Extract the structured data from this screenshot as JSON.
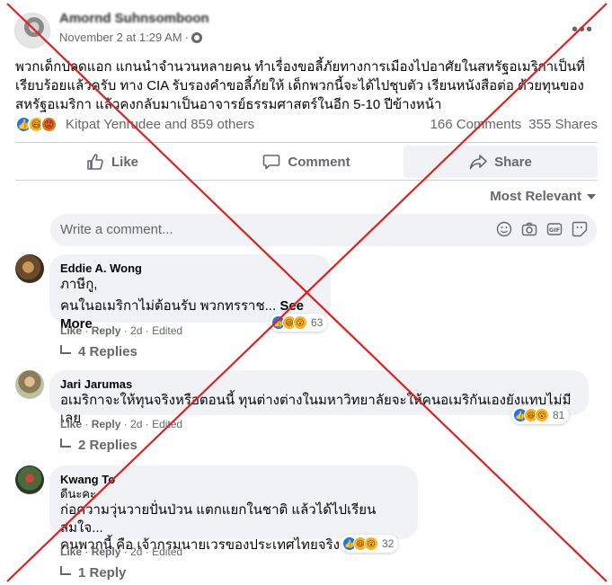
{
  "post": {
    "author": "Amornd Suhnsomboon",
    "timestamp": "November 2 at 1:29 AM",
    "separator": "·",
    "text": "พวกเด็กปลดแอก แกนนำจำนวนหลายคน ทำเรื่องขอลี้ภัยทางการเมืองไปอาศัยในสหรัฐอเมริกาเป็นที่เรียบร้อยแล้วครับ ทาง CIA รับรองคำขอลี้ภัยให้ เด็กพวกนี้จะได้ไปชุบตัว เรียนหนังสือต่อ ด้วยทุนของสหรัฐอเมริกา แล้วคงกลับมาเป็นอาจารย์ธรรมศาสตร์ในอีก 5-10 ปีข้างหน้า",
    "reaction_names": "Kitpat Yenrudee and 859 others",
    "comments_count": "166 Comments",
    "shares_count": "355 Shares"
  },
  "actions": {
    "like": "Like",
    "comment": "Comment",
    "share": "Share"
  },
  "sort_label": "Most Relevant",
  "composer": {
    "placeholder": "Write a comment..."
  },
  "comments": [
    {
      "name": "Eddie A. Wong",
      "line1": "ภาษีกู,",
      "line2": "คนในอเมริกาไม่ต้อนรับ พวกทรราช...",
      "see_more": "See More",
      "reaction_count": "63",
      "like": "Like",
      "reply": "Reply",
      "time": "2d",
      "edited": "Edited",
      "replies": "4 Replies"
    },
    {
      "name": "Jari Jarumas",
      "line1": "อเมริกาจะให้ทุนจริงหรือตอนนี้ ทุนต่างต่างในมหาวิทยาลัยจะให้คนอเมริกันเองยังแทบไม่มีเลย",
      "reaction_count": "81",
      "like": "Like",
      "reply": "Reply",
      "time": "2d",
      "edited": "Edited",
      "replies": "2 Replies"
    },
    {
      "name": "Kwang To",
      "line1": "ดีนะคะ",
      "line2": "ก่อความวุ่นวายปั่นป่วน แตกแยกในชาติ แล้วได้ไปเรียนสมใจ...",
      "line3": "คนพวกนี้ คือ เจ้ากรมนายเวรของประเทศไทยจริงๆ‼️🧨",
      "reaction_count": "32",
      "like": "Like",
      "reply": "Reply",
      "time": "2d",
      "edited": "Edited",
      "replies": "1 Reply"
    }
  ],
  "colors": {
    "accent": "#1877f2",
    "cross": "#e02020",
    "muted": "#65676b"
  }
}
